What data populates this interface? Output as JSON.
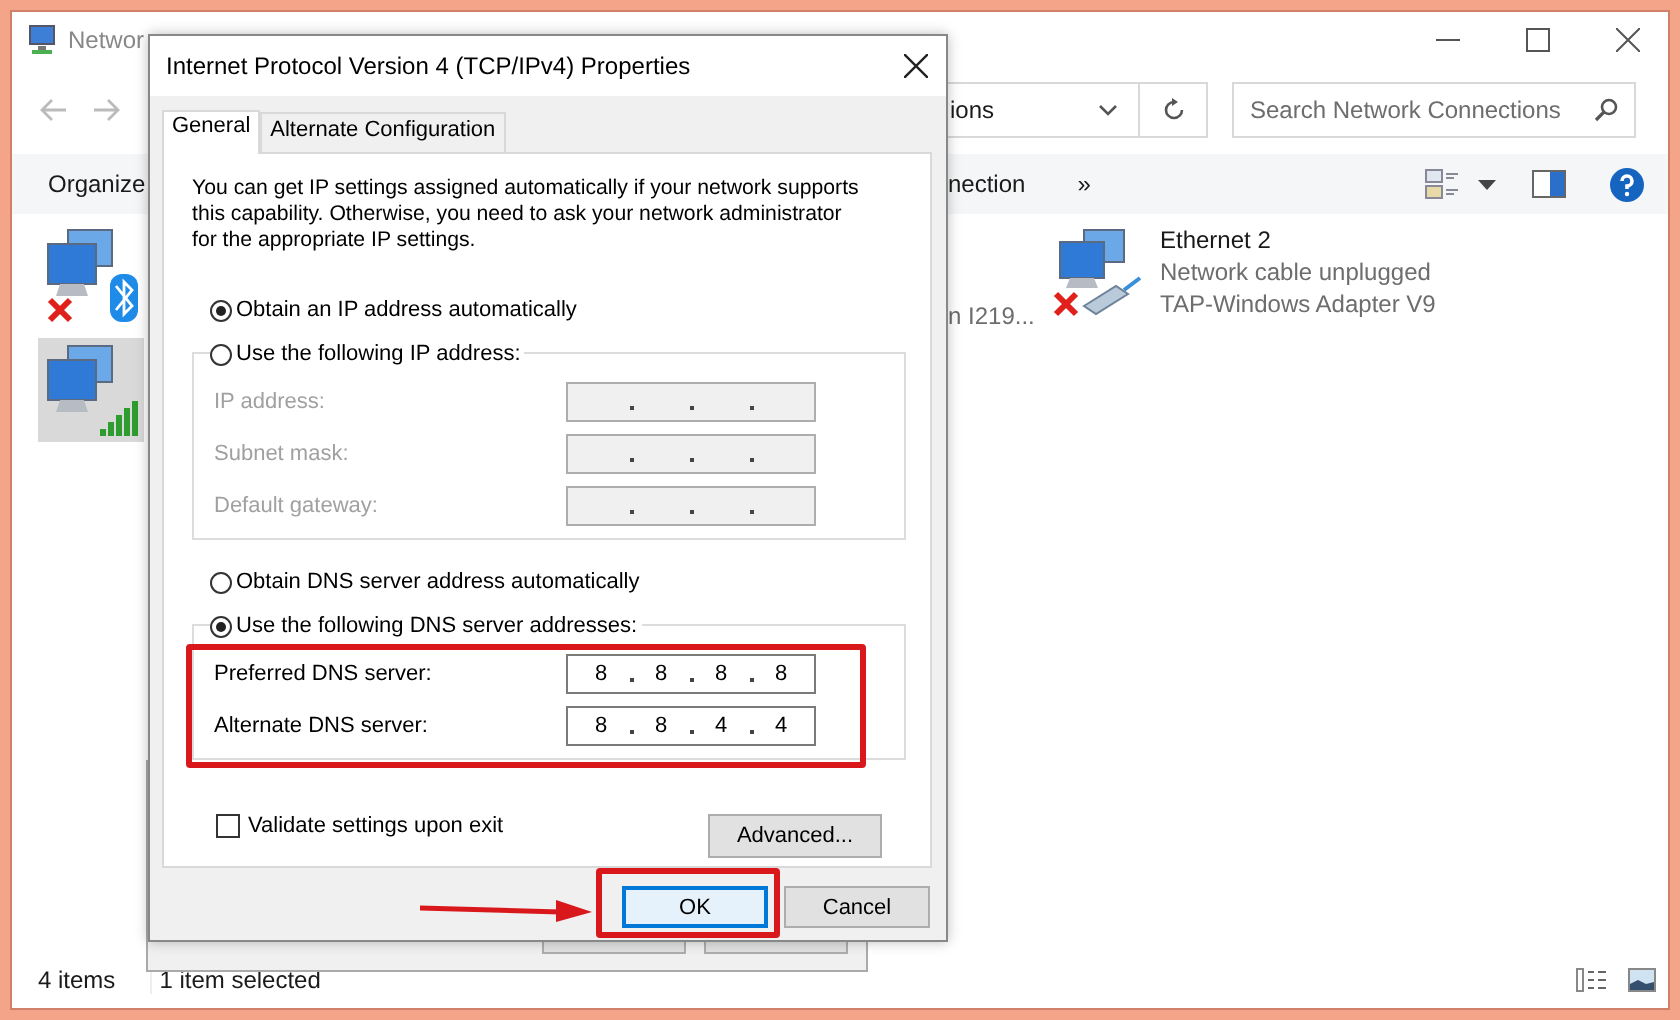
{
  "explorer": {
    "title": "Networ",
    "address": "ions",
    "search": {
      "placeholder": "Search Network Connections"
    },
    "toolbar": {
      "organize": "Organize",
      "action": "nection",
      "more": "»"
    },
    "left_items": [
      {
        "kind": "bluetooth",
        "disconnected": true,
        "selected": false
      },
      {
        "kind": "wifi",
        "disconnected": false,
        "selected": true
      }
    ],
    "partial_item": {
      "line": "n I219..."
    },
    "right_items": [
      {
        "kind": "cable",
        "disconnected": true,
        "selected": false,
        "name": "Ethernet 2",
        "status": "Network cable unplugged",
        "device": "TAP-Windows Adapter V9"
      }
    ],
    "status_bar": {
      "count": "4 items",
      "selection": "1 item selected"
    }
  },
  "dialog": {
    "title": "Internet Protocol Version 4 (TCP/IPv4) Properties",
    "tabs": [
      {
        "label": "General",
        "selected": true
      },
      {
        "label": "Alternate Configuration",
        "selected": false
      }
    ],
    "intro": "You can get IP settings assigned automatically if your network supports this capability. Otherwise, you need to ask your network administrator for the appropriate IP settings.",
    "ip_mode": [
      {
        "label": "Obtain an IP address automatically",
        "selected": true
      },
      {
        "label": "Use the following IP address:",
        "selected": false
      }
    ],
    "ip_fields": [
      {
        "label": "IP address:",
        "disabled": true
      },
      {
        "label": "Subnet mask:",
        "disabled": true
      },
      {
        "label": "Default gateway:",
        "disabled": true
      }
    ],
    "dns_mode": [
      {
        "label": "Obtain DNS server address automatically",
        "selected": false
      },
      {
        "label": "Use the following DNS server addresses:",
        "selected": true
      }
    ],
    "dns_fields": [
      {
        "label": "Preferred DNS server:",
        "disabled": false,
        "octets": [
          "8",
          "8",
          "8",
          "8"
        ]
      },
      {
        "label": "Alternate DNS server:",
        "disabled": false,
        "octets": [
          "8",
          "8",
          "4",
          "4"
        ]
      }
    ],
    "validate": {
      "label": "Validate settings upon exit",
      "checked": false
    },
    "advanced": "Advanced...",
    "buttons": [
      {
        "label": "OK",
        "focused": true
      },
      {
        "label": "Cancel",
        "focused": false
      }
    ]
  }
}
